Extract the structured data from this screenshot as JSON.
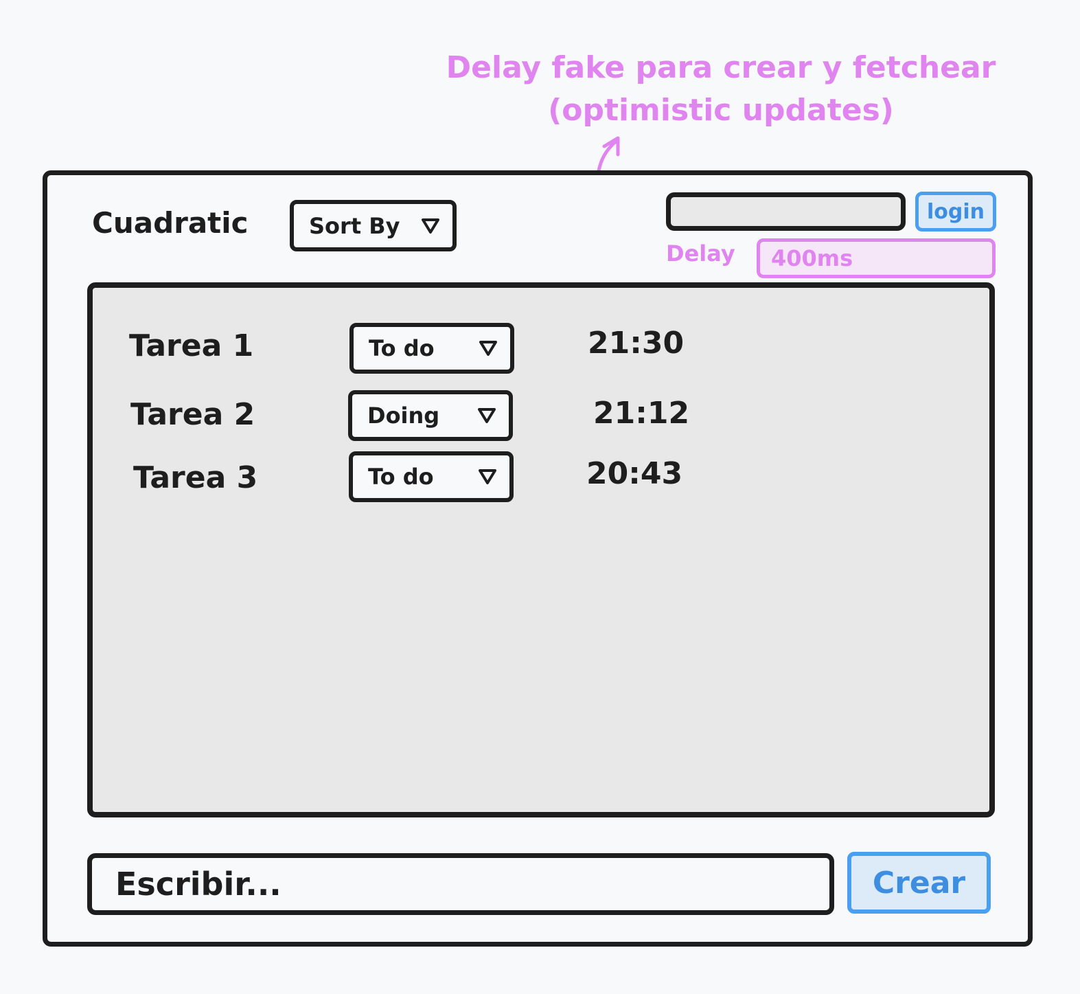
{
  "annotation": {
    "line1": "Delay fake para crear y fetchear",
    "line2": "(optimistic updates)",
    "color": "#e085ef"
  },
  "header": {
    "app_title": "Cuadratic",
    "sort_label": "Sort By",
    "login_label": "login",
    "login_value": "",
    "delay_label": "Delay",
    "delay_value": "400ms"
  },
  "tasks": [
    {
      "name": "Tarea 1",
      "status": "To do",
      "time": "21:30"
    },
    {
      "name": "Tarea 2",
      "status": "Doing",
      "time": "21:12"
    },
    {
      "name": "Tarea 3",
      "status": "To do",
      "time": "20:43"
    }
  ],
  "composer": {
    "placeholder": "Escribir...",
    "create_label": "Crear"
  },
  "colors": {
    "ink": "#1e1e1e",
    "accent_blue": "#4a9ff0",
    "accent_pink": "#e085ef",
    "panel_fill": "#e8e8e8"
  }
}
